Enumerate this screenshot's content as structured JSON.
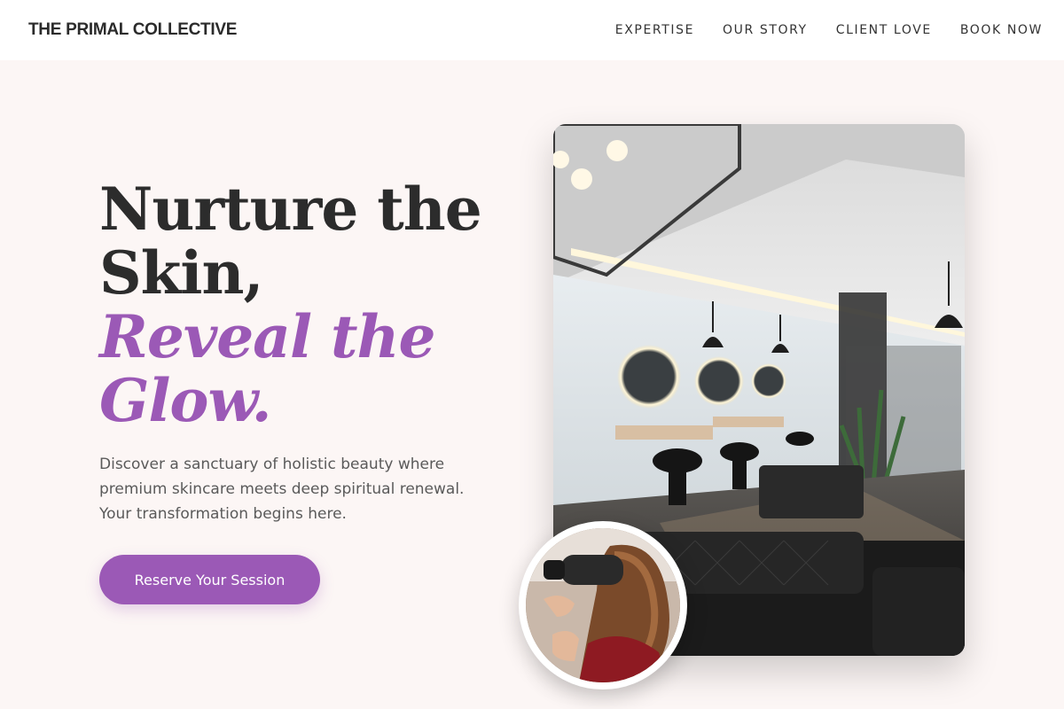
{
  "header": {
    "brand": "THE PRIMAL COLLECTIVE",
    "nav": [
      {
        "label": "EXPERTISE"
      },
      {
        "label": "OUR STORY"
      },
      {
        "label": "CLIENT LOVE"
      },
      {
        "label": "BOOK NOW"
      }
    ]
  },
  "hero": {
    "title_line1": "Nurture the",
    "title_line2": "Skin,",
    "title_accent1": "Reveal the",
    "title_accent2": "Glow.",
    "description": "Discover a sanctuary of holistic beauty where premium skincare meets deep spiritual renewal. Your transformation begins here.",
    "cta_label": "Reserve Your Session"
  },
  "colors": {
    "accent": "#9b59b6",
    "background": "#fcf6f5",
    "text": "#2c2c2c"
  }
}
